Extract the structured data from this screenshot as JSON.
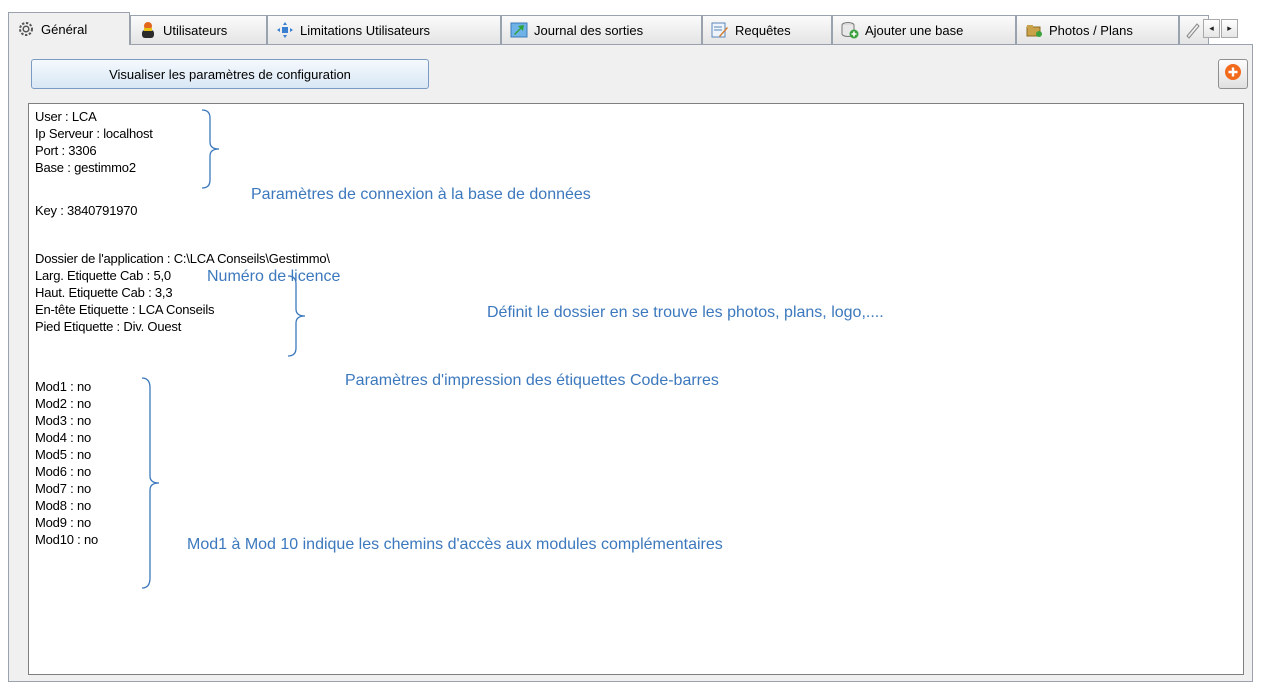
{
  "tabs": [
    {
      "label": "Général",
      "icon": "gear-icon",
      "active": true
    },
    {
      "label": "Utilisateurs",
      "icon": "user-icon"
    },
    {
      "label": "Limitations Utilisateurs",
      "icon": "move-arrows-icon"
    },
    {
      "label": "Journal des sorties",
      "icon": "exit-log-icon"
    },
    {
      "label": "Requêtes",
      "icon": "query-edit-icon"
    },
    {
      "label": "Ajouter une base",
      "icon": "add-database-icon"
    },
    {
      "label": "Photos / Plans",
      "icon": "photo-folder-icon"
    }
  ],
  "scroll_buttons": {
    "left": "◂",
    "right": "▸"
  },
  "toolbar": {
    "visualiser_label": "Visualiser les paramètres de configuration",
    "add_icon": "plus-circle-icon",
    "accent": "#f26b1d"
  },
  "config": {
    "connection": [
      "User : LCA",
      "Ip Serveur : localhost",
      "Port : 3306",
      "Base : gestimmo2"
    ],
    "key": "Key : 3840791970",
    "dossier": "Dossier de l'application : C:\\LCA Conseils\\Gestimmo\\",
    "etiquette": [
      "Larg. Etiquette Cab : 5,0",
      "Haut. Etiquette Cab : 3,3",
      "En-tête Etiquette : LCA Conseils",
      "Pied Etiquette : Div. Ouest"
    ],
    "modules": [
      "Mod1 : no",
      "Mod2 : no",
      "Mod3 : no",
      "Mod4 : no",
      "Mod5 : no",
      "Mod6 : no",
      "Mod7 : no",
      "Mod8 : no",
      "Mod9 : no",
      "Mod10 : no"
    ]
  },
  "annotations": {
    "connection": "Paramètres de connexion à la base de données",
    "licence": "Numéro de licence",
    "dossier": "Définit le dossier en se trouve les photos, plans, logo,....",
    "etiquette": "Paramètres d'impression des étiquettes Code-barres",
    "modules": "Mod1 à Mod 10 indique les chemins d'accès aux modules complémentaires",
    "color": "#3c78bd"
  }
}
